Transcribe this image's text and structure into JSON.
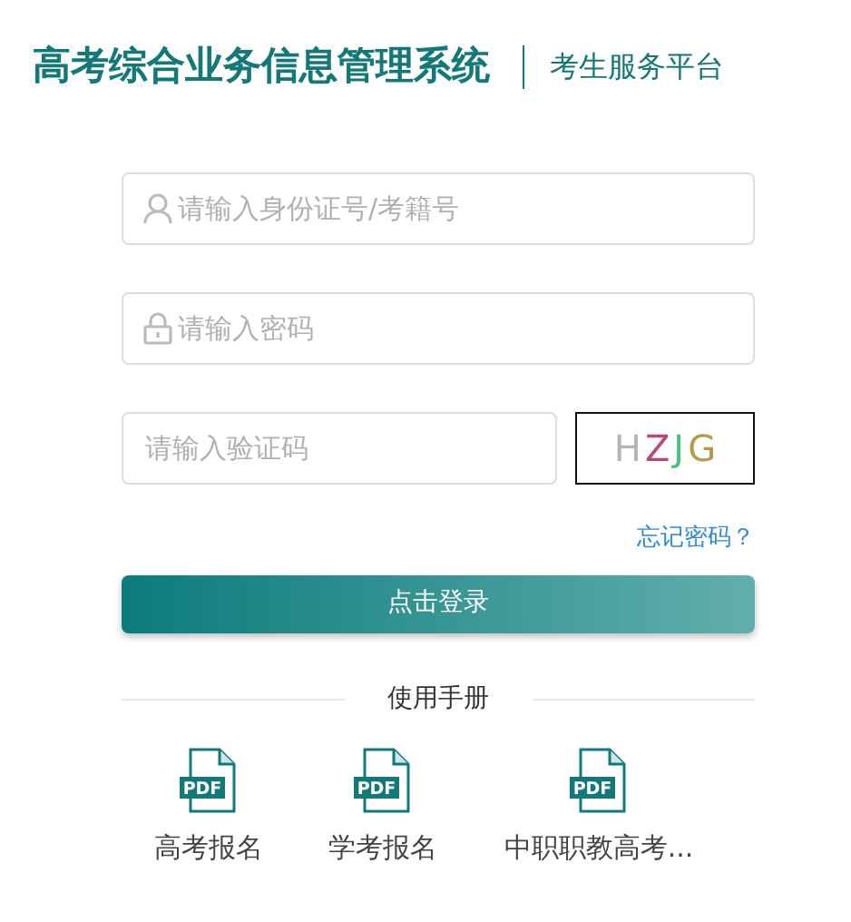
{
  "header": {
    "title": "高考综合业务信息管理系统",
    "subtitle": "考生服务平台"
  },
  "form": {
    "fields": [
      {
        "kind": "user",
        "placeholder": "请输入身份证号/考籍号"
      },
      {
        "kind": "lock",
        "placeholder": "请输入密码"
      },
      {
        "kind": "captcha",
        "placeholder": "请输入验证码"
      }
    ],
    "captcha": [
      {
        "char": "H",
        "color": "#b4b4b4"
      },
      {
        "char": "Z",
        "color": "#b8487a"
      },
      {
        "char": "J",
        "color": "#4cc07e"
      },
      {
        "char": "G",
        "color": "#b59a4a"
      }
    ],
    "forgot_link": "忘记密码？",
    "submit": "点击登录"
  },
  "manuals": {
    "heading": "使用手册",
    "items": [
      {
        "icon_text": "PDF",
        "label": "高考报名"
      },
      {
        "icon_text": "PDF",
        "label": "学考报名"
      },
      {
        "icon_text": "PDF",
        "label": "中职职教高考..."
      }
    ]
  }
}
